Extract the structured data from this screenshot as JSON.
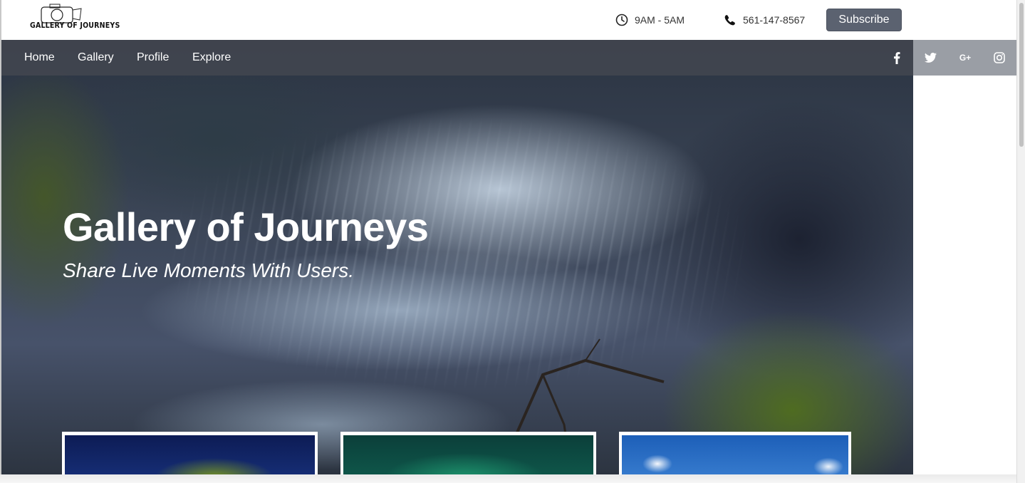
{
  "brand": {
    "logo_text": "GALLERY OF JOURNEYS"
  },
  "contact": {
    "hours": "9AM - 5AM",
    "phone": "561-147-8567"
  },
  "header": {
    "subscribe_label": "Subscribe"
  },
  "nav": {
    "items": [
      "Home",
      "Gallery",
      "Profile",
      "Explore"
    ]
  },
  "social": {
    "icons": [
      "facebook-icon",
      "twitter-icon",
      "google-plus-icon",
      "instagram-icon"
    ],
    "google_plus_glyph": "G+"
  },
  "hero": {
    "title": "Gallery of Journeys",
    "subtitle": "Share Live Moments With Users."
  },
  "cards": [
    {
      "image": "palm-tree-photo"
    },
    {
      "image": "aurora-photo"
    },
    {
      "image": "sky-building-photo"
    }
  ],
  "colors": {
    "subscribe_bg": "#5b6270",
    "nav_bg": "rgba(70,74,82,0.72)",
    "social_strip_bg": "#9a9ea5"
  }
}
